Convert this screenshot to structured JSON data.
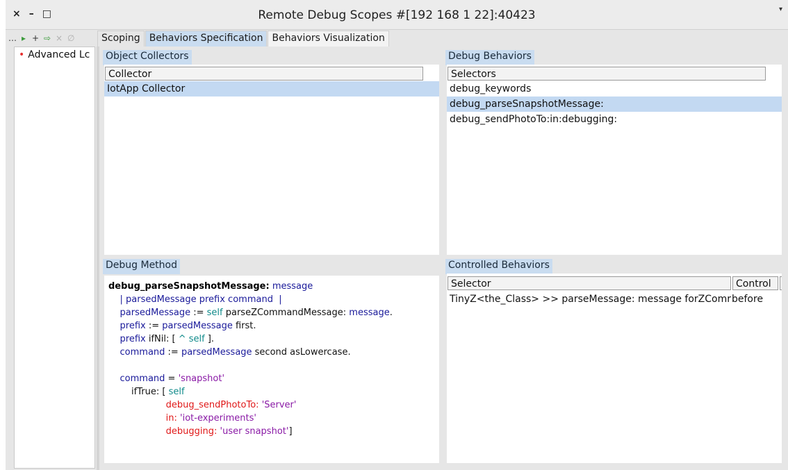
{
  "window": {
    "title": "Remote Debug Scopes #[192 168 1 22]:40423",
    "controls": [
      "×",
      "–",
      "□"
    ],
    "menu_glyph": "▾"
  },
  "toolbar": {
    "icons": [
      "…",
      "▸",
      "+",
      "⇨",
      "×",
      "∅"
    ]
  },
  "tabs": [
    "Scoping",
    "Behaviors Specification",
    "Behaviors Visualization"
  ],
  "sidebar": {
    "items": [
      {
        "label": "Advanced Lc"
      }
    ]
  },
  "object_collectors": {
    "title": "Object Collectors",
    "column": "Collector",
    "rows": [
      "IotApp Collector"
    ],
    "selected_index": 0
  },
  "debug_behaviors": {
    "title": "Debug Behaviors",
    "column": "Selectors",
    "rows": [
      "debug_keywords",
      "debug_parseSnapshotMessage:",
      "debug_sendPhotoTo:in:debugging:"
    ],
    "selected_index": 1
  },
  "debug_method": {
    "title": "Debug Method",
    "lines": [
      [
        {
          "t": "debug_parseSnapshotMessage:",
          "c": "bold"
        },
        {
          "t": " message",
          "c": "k"
        }
      ],
      [
        {
          "t": "    | parsedMessage prefix command  |",
          "c": "k"
        }
      ],
      [
        {
          "t": "    parsedMessage",
          "c": "k"
        },
        {
          "t": " := ",
          "c": "bk"
        },
        {
          "t": "self",
          "c": "sf"
        },
        {
          "t": " parseZCommandMessage: ",
          "c": "bk"
        },
        {
          "t": "message",
          "c": "k"
        },
        {
          "t": ".",
          "c": "bk"
        }
      ],
      [
        {
          "t": "    prefix",
          "c": "k"
        },
        {
          "t": " := ",
          "c": "bk"
        },
        {
          "t": "parsedMessage",
          "c": "k"
        },
        {
          "t": " first.",
          "c": "bk"
        }
      ],
      [
        {
          "t": "    prefix",
          "c": "k"
        },
        {
          "t": " ifNil: [ ",
          "c": "bk"
        },
        {
          "t": "^ self",
          "c": "sf"
        },
        {
          "t": " ].",
          "c": "bk"
        }
      ],
      [
        {
          "t": "    command",
          "c": "k"
        },
        {
          "t": " := ",
          "c": "bk"
        },
        {
          "t": "parsedMessage",
          "c": "k"
        },
        {
          "t": " second asLowercase.",
          "c": "bk"
        }
      ],
      [
        {
          "t": "",
          "c": "bk"
        }
      ],
      [
        {
          "t": "    command",
          "c": "k"
        },
        {
          "t": " = ",
          "c": "bk"
        },
        {
          "t": "'snapshot'",
          "c": "st"
        }
      ],
      [
        {
          "t": "        ifTrue: [ ",
          "c": "bk"
        },
        {
          "t": "self",
          "c": "sf"
        }
      ],
      [
        {
          "t": "                    debug_sendPhotoTo: ",
          "c": "rd"
        },
        {
          "t": "'Server'",
          "c": "st"
        }
      ],
      [
        {
          "t": "                    in: ",
          "c": "rd"
        },
        {
          "t": "'iot-experiments'",
          "c": "st"
        }
      ],
      [
        {
          "t": "                    debugging: ",
          "c": "rd"
        },
        {
          "t": "'user snapshot'",
          "c": "st"
        },
        {
          "t": "]",
          "c": "bk"
        }
      ]
    ]
  },
  "controlled_behaviors": {
    "title": "Controlled Behaviors",
    "columns": [
      "Selector",
      "Control"
    ],
    "rows": [
      {
        "selector": "TinyZ<the_Class> >> parseMessage: message forZComr",
        "control": "before"
      }
    ]
  }
}
